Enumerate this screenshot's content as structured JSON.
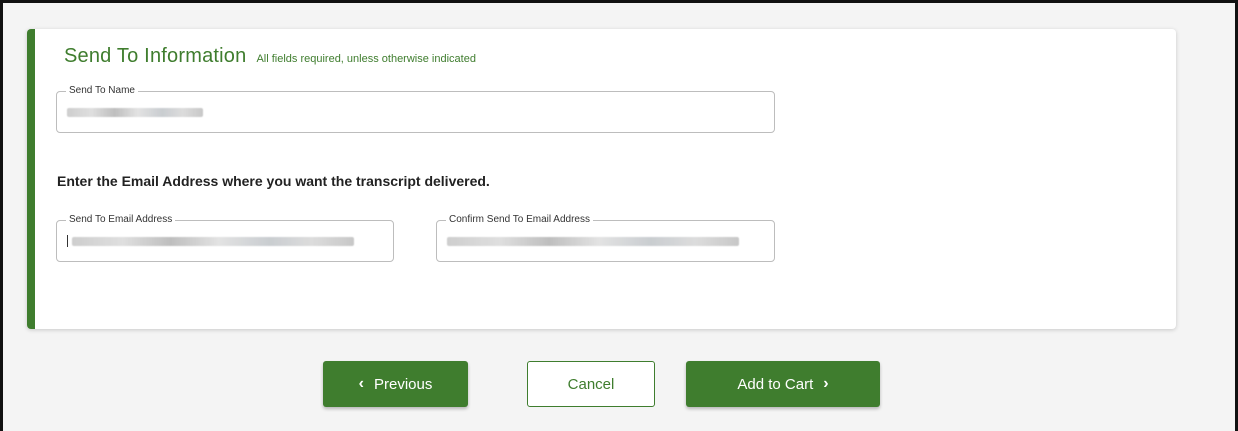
{
  "section": {
    "title": "Send To Information",
    "subtitle": "All fields required, unless otherwise indicated"
  },
  "send_to_name": {
    "label": "Send To Name",
    "value_redacted": true
  },
  "email_prompt": "Enter the Email Address where you want the transcript delivered.",
  "send_to_email": {
    "label": "Send To Email Address",
    "value_redacted": true
  },
  "confirm_email": {
    "label": "Confirm Send To Email Address",
    "value_redacted": true
  },
  "buttons": {
    "previous": "Previous",
    "cancel": "Cancel",
    "add_to_cart": "Add to Cart"
  },
  "icons": {
    "previous": "chevron-left-icon",
    "add_to_cart": "chevron-right-icon"
  },
  "colors": {
    "accent": "#3f7d2e",
    "background": "#f4f4f4",
    "card": "#ffffff"
  }
}
